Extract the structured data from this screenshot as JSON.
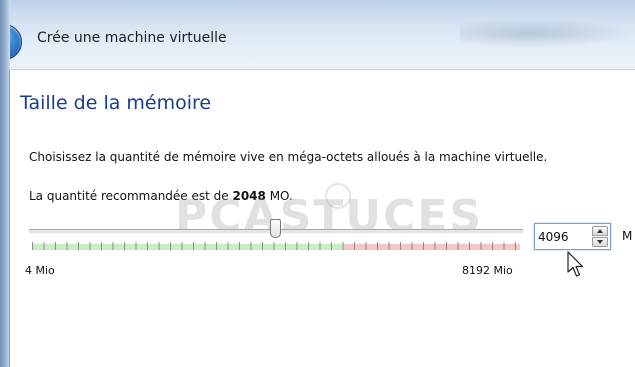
{
  "window": {
    "title": "Crée une machine virtuelle"
  },
  "page": {
    "heading": "Taille de la mémoire",
    "description": "Choisissez la quantité de mémoire vive en méga-octets alloués à la machine virtuelle.",
    "recommended_prefix": "La quantité recommandée est de ",
    "recommended_value": "2048",
    "recommended_suffix": " MO."
  },
  "memory": {
    "slider_min_label": "4 Mio",
    "slider_max_label": "8192 Mio",
    "slider_min": 4,
    "slider_max": 8192,
    "slider_value": 4096,
    "spin_value": "4096",
    "unit_label": "M"
  },
  "watermark": {
    "text": "PCASTUCES"
  },
  "colors": {
    "heading": "#1a3e8c",
    "scale_safe": "#c9edc5",
    "scale_danger": "#f4c6c4"
  },
  "icons": {
    "back": "back-arrow-icon",
    "cursor": "mouse-pointer-icon"
  }
}
